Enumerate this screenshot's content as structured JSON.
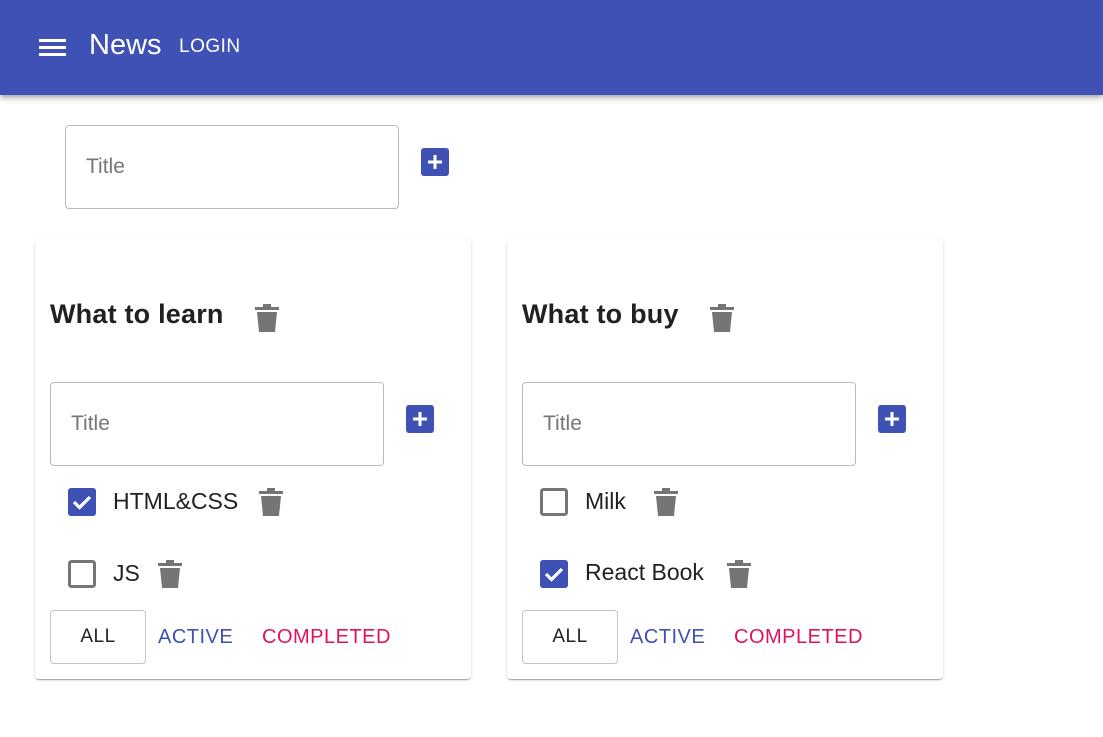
{
  "appbar": {
    "title": "News",
    "login_label": "LOGIN",
    "color": "#3f51b5"
  },
  "new_list": {
    "placeholder": "Title"
  },
  "todolists": [
    {
      "title": "What to learn",
      "input_placeholder": "Title",
      "tasks": [
        {
          "label": "HTML&CSS",
          "checked": true
        },
        {
          "label": "JS",
          "checked": false
        }
      ],
      "filters": {
        "all": "ALL",
        "active": "ACTIVE",
        "completed": "COMPLETED"
      }
    },
    {
      "title": "What to buy",
      "input_placeholder": "Title",
      "tasks": [
        {
          "label": "Milk",
          "checked": false
        },
        {
          "label": "React Book",
          "checked": true
        }
      ],
      "filters": {
        "all": "ALL",
        "active": "ACTIVE",
        "completed": "COMPLETED"
      }
    }
  ],
  "icons": {
    "menu": "menu-icon",
    "add": "add-box-icon",
    "delete": "trash-icon",
    "checked": "checkbox-checked-icon",
    "unchecked": "checkbox-unchecked-icon"
  },
  "colors": {
    "primary": "#3f51b5",
    "secondary": "#e0115f",
    "icon_gray": "#757575"
  }
}
